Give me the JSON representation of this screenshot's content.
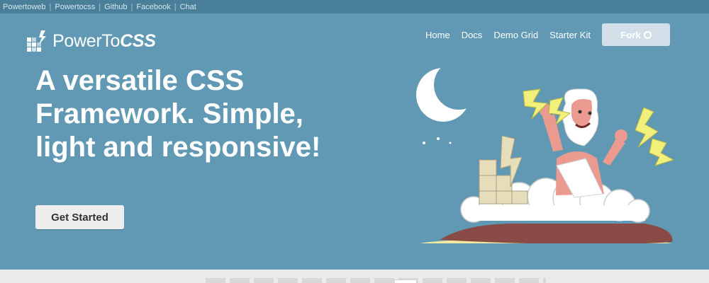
{
  "topbar": {
    "links": [
      "Powertoweb",
      "Powertocss",
      "Github",
      "Facebook",
      "Chat"
    ]
  },
  "brand": {
    "name_prefix": "PowerTo",
    "name_suffix": "CSS"
  },
  "nav": {
    "items": [
      "Home",
      "Docs",
      "Demo Grid",
      "Starter Kit"
    ],
    "fork_label": "Fork"
  },
  "hero": {
    "headline": "A versatile CSS Framework. Simple, light and responsive!",
    "cta_label": "Get Started"
  },
  "colors": {
    "hero_bg": "#6199b4",
    "topbar_bg": "#4a7f99",
    "button_bg": "#eeeeee",
    "fork_bg": "#d2dfe8"
  }
}
